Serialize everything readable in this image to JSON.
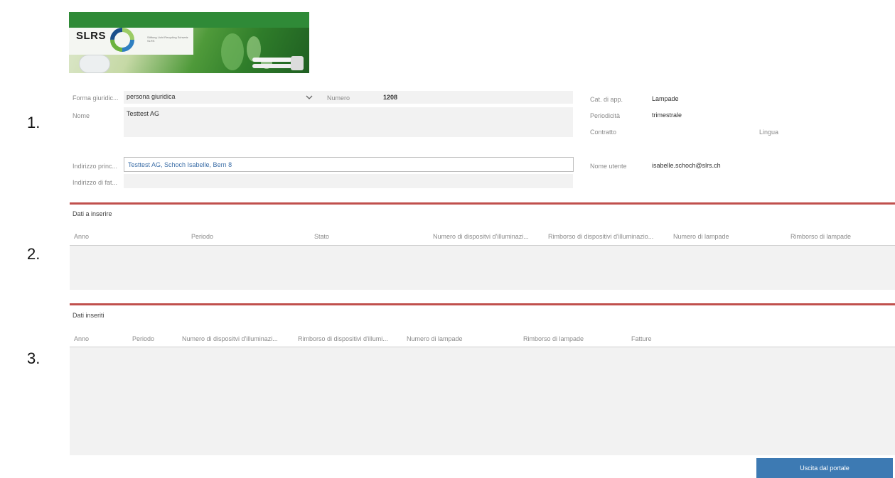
{
  "logo": {
    "brand": "SLRS",
    "tagline": "Stiftung Licht Recycling Schweiz SLRS"
  },
  "section_numbers": [
    "1.",
    "2.",
    "3."
  ],
  "form": {
    "legal_form_label": "Forma giuridic...",
    "legal_form_value": "persona giuridica",
    "number_label": "Numero",
    "number_value": "1208",
    "name_label": "Nome",
    "name_value": "Testtest AG",
    "main_address_label": "Indirizzo princ...",
    "main_address_value": "Testtest AG, Schoch Isabelle, Bern 8",
    "billing_address_label": "Indirizzo di fat...",
    "device_cat_label": "Cat. di app.",
    "device_cat_value": "Lampade",
    "periodicity_label": "Periodicità",
    "periodicity_value": "trimestrale",
    "contract_label": "Contratto",
    "language_label": "Lingua",
    "username_label": "Nome utente",
    "username_value": "isabelle.schoch@slrs.ch"
  },
  "data_to_enter": {
    "title": "Dati a inserire",
    "columns": [
      "Anno",
      "Periodo",
      "Stato",
      "Numero di dispositvi d'illuminazi...",
      "Rimborso di dispositivi d'illuminazio...",
      "Numero di lampade",
      "Rimborso di lampade"
    ]
  },
  "data_entered": {
    "title": "Dati inseriti",
    "columns": [
      "Anno",
      "Periodo",
      "Numero di dispositvi d'illuminazi...",
      "Rimborso di dispositivi d'illumi...",
      "Numero di lampade",
      "Rimborso di lampade",
      "Fatture"
    ]
  },
  "exit_button": "Uscita dal portale",
  "colors": {
    "accent_red": "#c0504d",
    "button_blue": "#3d7ab3",
    "field_gray": "#f2f2f2"
  }
}
